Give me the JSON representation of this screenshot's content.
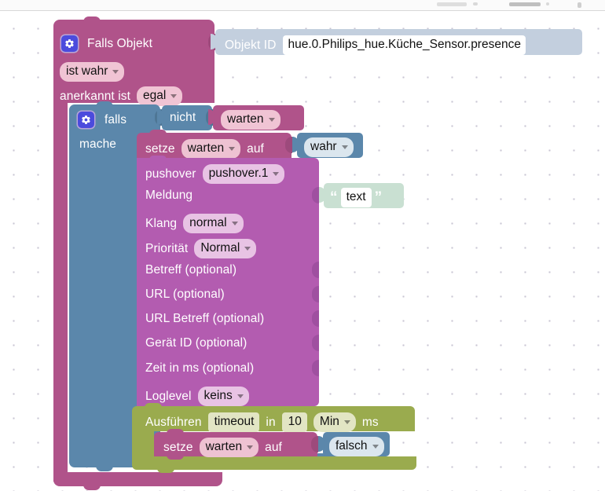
{
  "app": {
    "kind": "blockly-visual-script-editor",
    "canvas_background": "#ffffff",
    "grid_dot_color": "#c9c6d4"
  },
  "colors": {
    "mauve": "#b0538a",
    "mauve_light": "#bb5f92",
    "steel_blue": "#5b87ab",
    "purple": "#b35cb0",
    "olive": "#9aab4e",
    "mint": "#c9e0d2",
    "gear_blue": "#4b4bdd"
  },
  "blocks": {
    "trigger": {
      "name": "Falls Objekt",
      "gear_icon": "gear-icon",
      "object_id_label": "Objekt ID",
      "object_id_value": "hue.0.Philips_hue.Küche_Sensor.presence",
      "condition": "ist wahr",
      "ack_label": "anerkannt ist",
      "ack_value": "egal"
    },
    "if_block": {
      "gear_icon": "gear-icon",
      "if_label": "falls",
      "not_label": "nicht",
      "not_operand": "warten",
      "do_label": "mache"
    },
    "set_true": {
      "set_label": "setze",
      "variable": "warten",
      "to_label": "auf",
      "value": "wahr"
    },
    "pushover": {
      "title_label": "pushover",
      "instance": "pushover.1",
      "message_label": "Meldung",
      "message_value": "text",
      "quote_open": "“",
      "quote_close": "”",
      "sound_label": "Klang",
      "sound_value": "normal",
      "priority_label": "Priorität",
      "priority_value": "Normal",
      "subject_label": "Betreff (optional)",
      "url_label": "URL (optional)",
      "url_subject_label": "URL Betreff (optional)",
      "device_id_label": "Gerät ID (optional)",
      "time_ms_label": "Zeit in ms (optional)",
      "loglevel_label": "Loglevel",
      "loglevel_value": "keins"
    },
    "timeout": {
      "run_label": "Ausführen",
      "name_value": "timeout",
      "in_label": "in",
      "amount": "10",
      "unit": "Min",
      "unit_suffix": "ms"
    },
    "set_false": {
      "set_label": "setze",
      "variable": "warten",
      "to_label": "auf",
      "value": "falsch"
    }
  }
}
